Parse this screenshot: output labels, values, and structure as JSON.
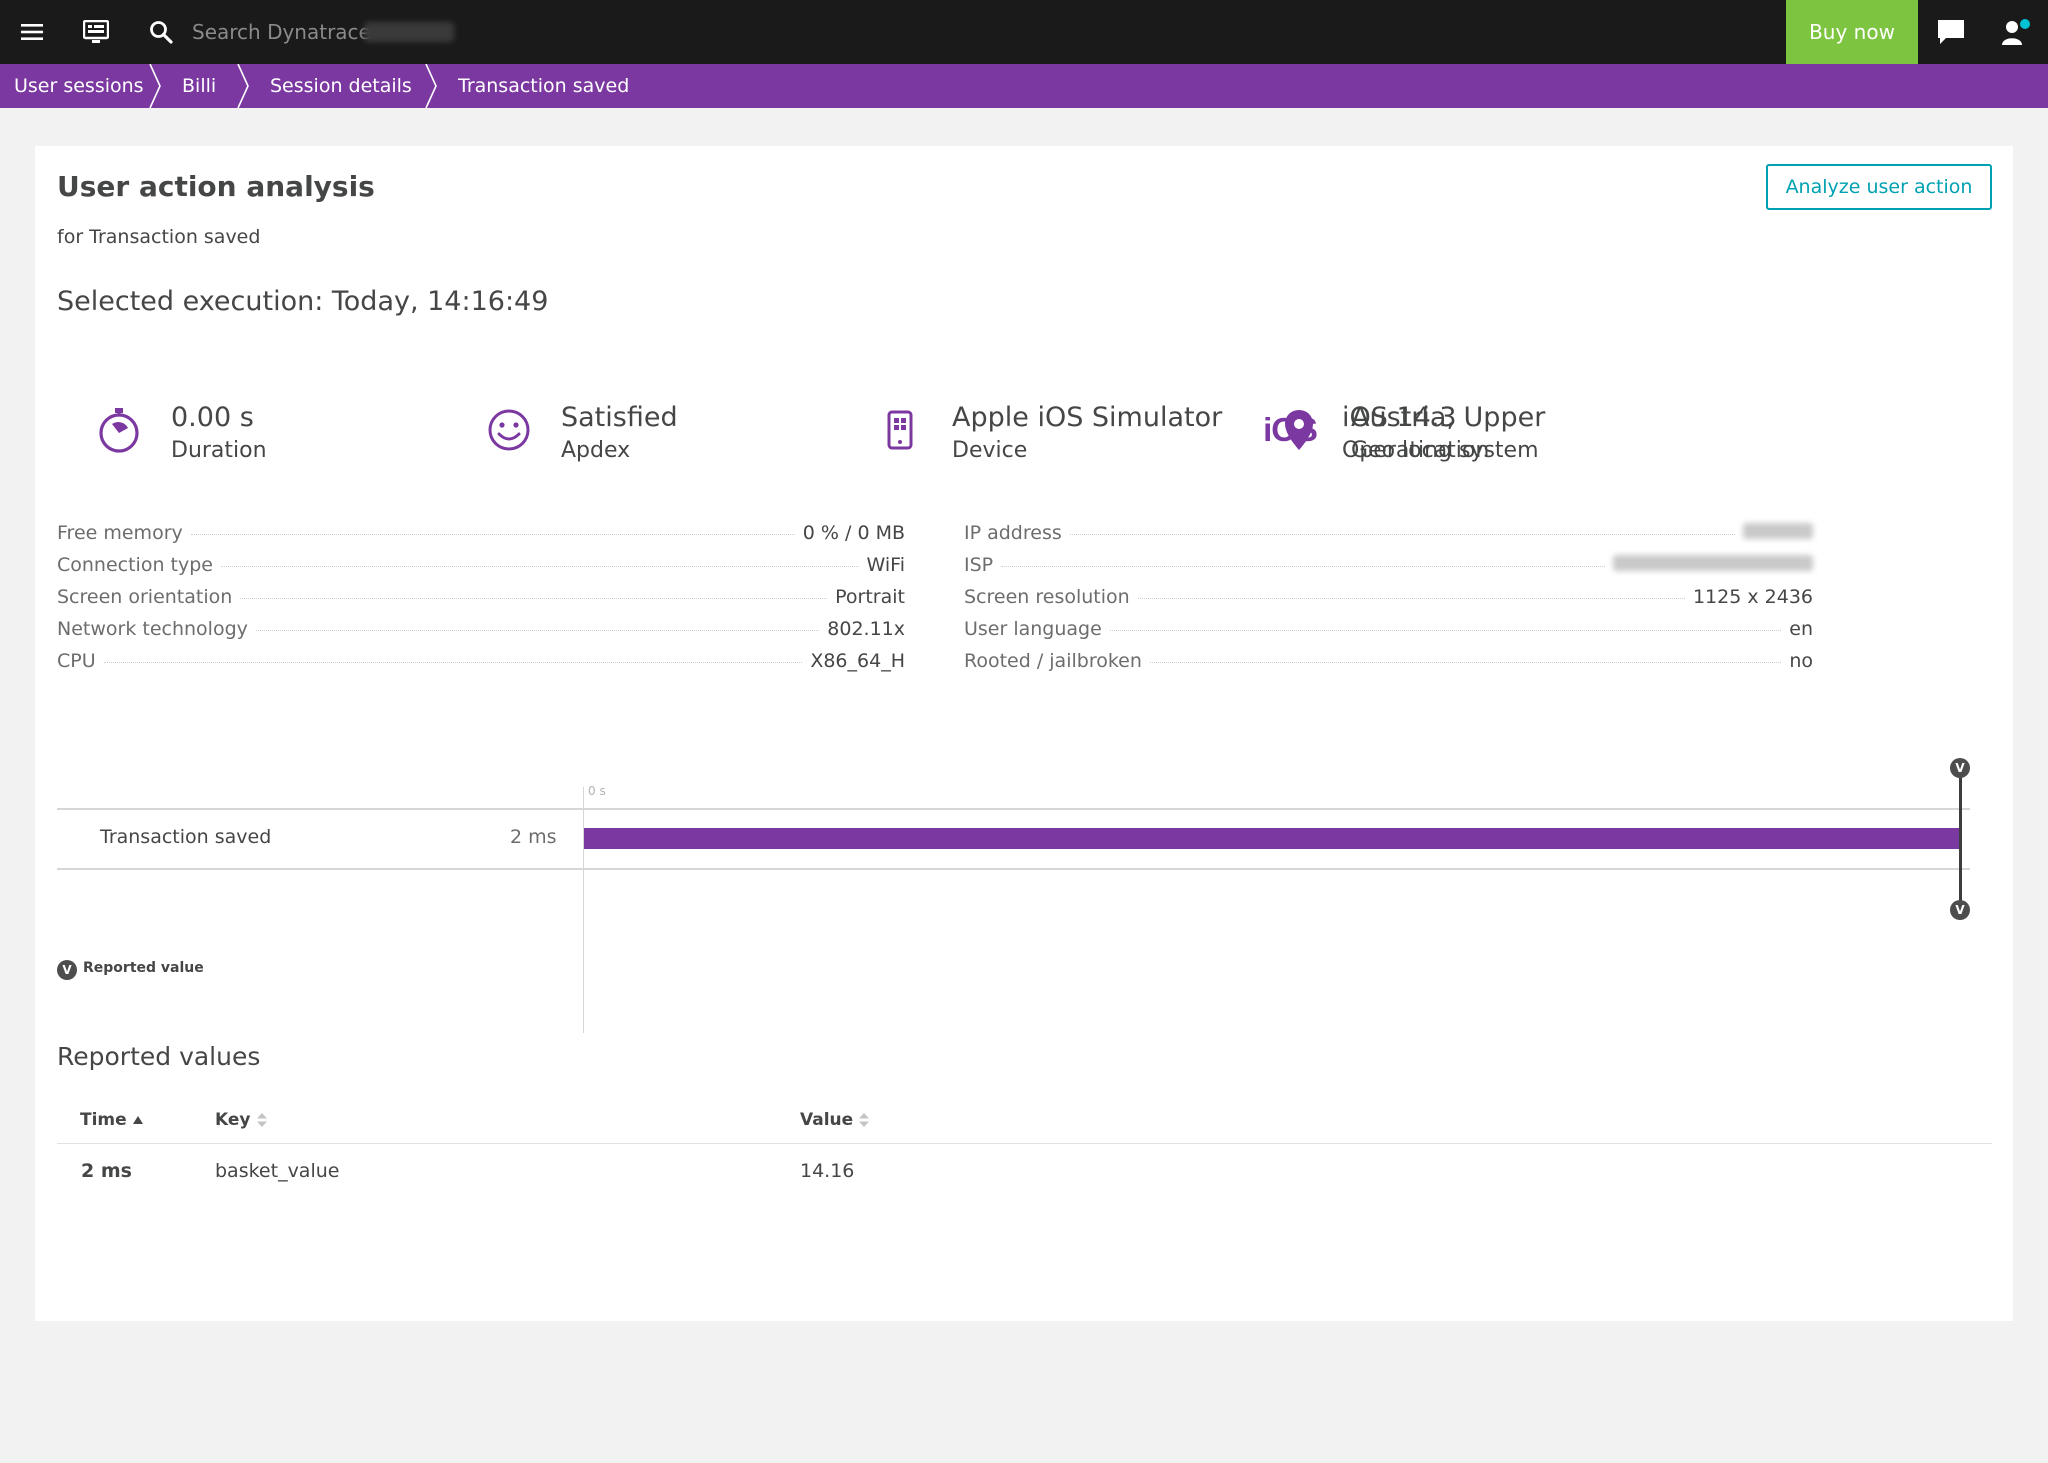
{
  "topbar": {
    "search_placeholder": "Search Dynatrace",
    "buy_label": "Buy now"
  },
  "breadcrumb": [
    "User sessions",
    "Billi",
    "Session details",
    "Transaction saved"
  ],
  "page": {
    "title": "User action analysis",
    "subtitle": "for Transaction saved",
    "execution": "Selected execution: Today, 14:16:49",
    "analyze_label": "Analyze user action"
  },
  "kpis": [
    {
      "value": "0.00 s",
      "label": "Duration",
      "icon": "stopwatch-icon"
    },
    {
      "value": "Satisfied",
      "label": "Apdex",
      "icon": "smiley-icon"
    },
    {
      "value": "Apple iOS Simulator",
      "label": "Device",
      "icon": "mobile-device-icon"
    },
    {
      "value": "iOS 14.3",
      "label": "Operating system",
      "icon": "ios-icon",
      "icon_text": "iOS"
    },
    {
      "value": "Austria, Upper Austr",
      "label": "Geo location",
      "icon": "location-pin-icon"
    }
  ],
  "properties_left": [
    {
      "key": "Free memory",
      "value": "0 % / 0 MB"
    },
    {
      "key": "Connection type",
      "value": "WiFi"
    },
    {
      "key": "Screen orientation",
      "value": "Portrait"
    },
    {
      "key": "Network technology",
      "value": "802.11x"
    },
    {
      "key": "CPU",
      "value": "X86_64_H"
    }
  ],
  "properties_right": [
    {
      "key": "IP address",
      "value": ""
    },
    {
      "key": "ISP",
      "value": ""
    },
    {
      "key": "Screen resolution",
      "value": "1125 x 2436"
    },
    {
      "key": "User language",
      "value": "en"
    },
    {
      "key": "Rooted / jailbroken",
      "value": "no"
    }
  ],
  "waterfall": {
    "tick_label": "0 s",
    "action_name": "Transaction saved",
    "action_duration": "2 ms",
    "marker_label": "V",
    "legend_label": "Reported value"
  },
  "reported_values": {
    "title": "Reported values",
    "headers": [
      "Time",
      "Key",
      "Value"
    ],
    "rows": [
      {
        "time": "2 ms",
        "key": "basket_value",
        "value": "14.16"
      }
    ]
  },
  "colors": {
    "accent": "#7c38a1",
    "buy": "#7dc540",
    "link": "#00a1b2",
    "topbar": "#1a1a1a"
  }
}
